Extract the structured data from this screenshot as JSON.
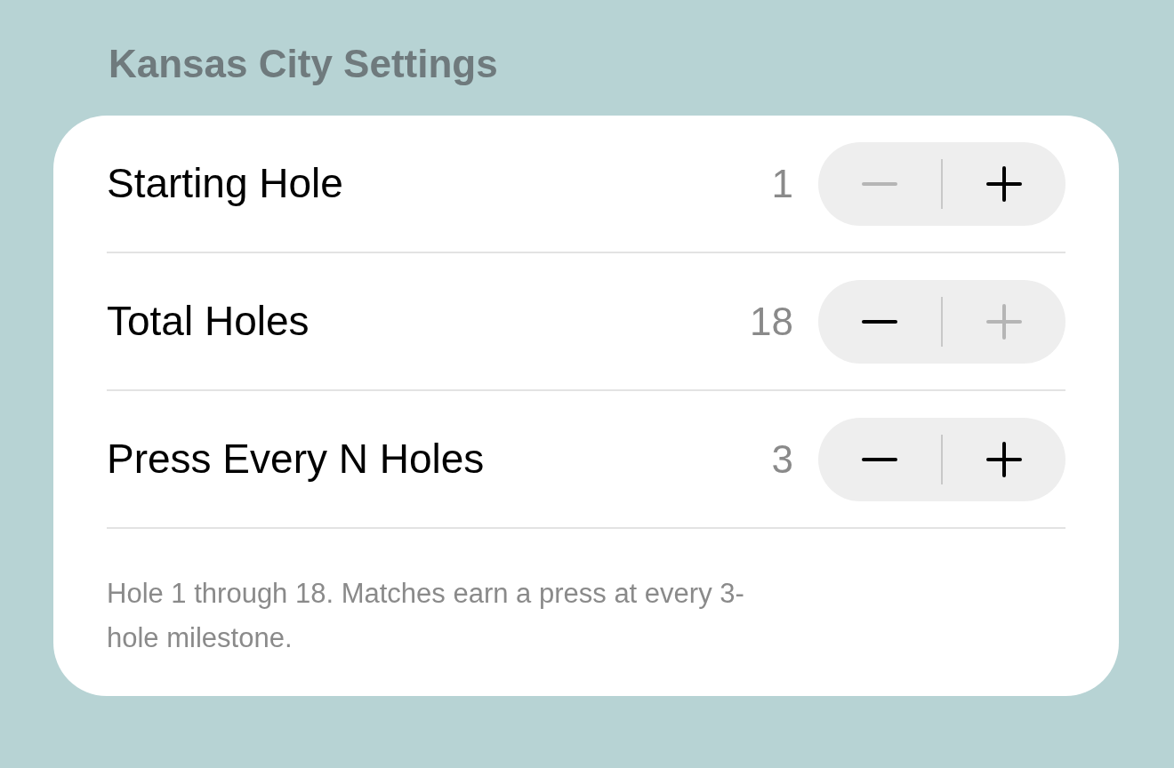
{
  "section_title": "Kansas City Settings",
  "rows": [
    {
      "label": "Starting Hole",
      "value": "1",
      "decrement_disabled": true,
      "increment_disabled": false
    },
    {
      "label": "Total Holes",
      "value": "18",
      "decrement_disabled": false,
      "increment_disabled": true
    },
    {
      "label": "Press Every N Holes",
      "value": "3",
      "decrement_disabled": false,
      "increment_disabled": false
    }
  ],
  "footer": "Hole 1 through 18. Matches earn a press at every 3-hole milestone."
}
